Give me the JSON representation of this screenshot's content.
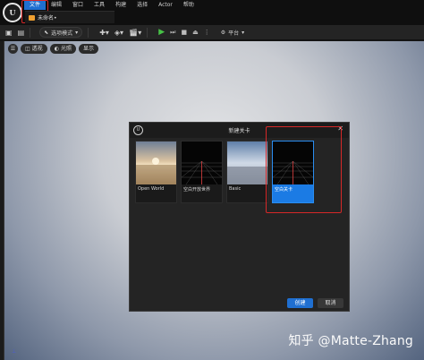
{
  "app": {
    "logo": "U",
    "tab_title": "未命名•"
  },
  "menu": [
    "文件",
    "编辑",
    "窗口",
    "工具",
    "构建",
    "选择",
    "Actor",
    "帮助"
  ],
  "toolbar": {
    "mode_label": "选项模式",
    "platform_label": "平台"
  },
  "viewport": {
    "perspective_label": "透视",
    "lit_label": "光照",
    "show_label": "显示",
    "watermark": "知乎 @Matte-Zhang"
  },
  "dialog": {
    "title": "新建关卡",
    "logo": "U",
    "close": "✕",
    "tiles": [
      {
        "label": "Open World",
        "image": "sunset-scene"
      },
      {
        "label": "空白开放世界",
        "image": "grid"
      },
      {
        "label": "Basic",
        "image": "sky-scene"
      },
      {
        "label": "空白关卡",
        "image": "grid",
        "selected": true
      }
    ],
    "create_label": "创建",
    "cancel_label": "取消"
  },
  "colors": {
    "accent": "#1f6fd1",
    "highlight": "#d62828",
    "play": "#47c247"
  }
}
